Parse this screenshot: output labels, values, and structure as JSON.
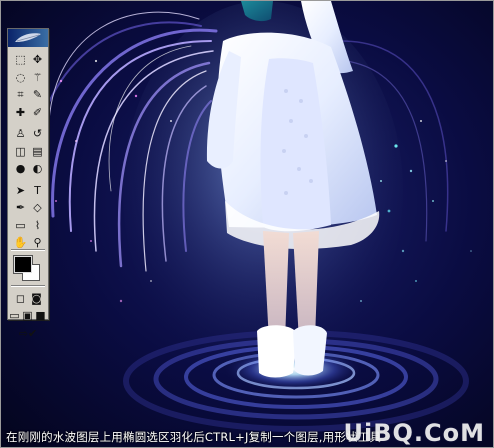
{
  "caption": "在刚刚的水波图层上用椭圆选区羽化后CTRL+J复制一个图层,用形状工具",
  "watermark": "UiBQ.CoM",
  "colors": {
    "background": "#06072e",
    "swirl": "#8a7cf2",
    "glow": "#dff6ff",
    "coat": "#eef3ff",
    "toolbox": "#d4d0c8"
  },
  "toolbox": {
    "tools": [
      {
        "name": "marquee-tool-icon",
        "glyph": "⬚"
      },
      {
        "name": "move-tool-icon",
        "glyph": "✥"
      },
      {
        "name": "lasso-tool-icon",
        "glyph": "◌"
      },
      {
        "name": "magic-wand-tool-icon",
        "glyph": "⚚"
      },
      {
        "name": "crop-tool-icon",
        "glyph": "⌗"
      },
      {
        "name": "slice-tool-icon",
        "glyph": "✎"
      },
      {
        "name": "healing-brush-tool-icon",
        "glyph": "✚"
      },
      {
        "name": "brush-tool-icon",
        "glyph": "✐"
      },
      {
        "name": "clone-stamp-tool-icon",
        "glyph": "♙"
      },
      {
        "name": "history-brush-tool-icon",
        "glyph": "↺"
      },
      {
        "name": "eraser-tool-icon",
        "glyph": "◫"
      },
      {
        "name": "gradient-tool-icon",
        "glyph": "▤"
      },
      {
        "name": "blur-tool-icon",
        "glyph": "●"
      },
      {
        "name": "dodge-tool-icon",
        "glyph": "◐"
      },
      {
        "name": "path-selection-tool-icon",
        "glyph": "➤"
      },
      {
        "name": "type-tool-icon",
        "glyph": "T"
      },
      {
        "name": "pen-tool-icon",
        "glyph": "✒"
      },
      {
        "name": "shape-tool-icon",
        "glyph": "◇"
      },
      {
        "name": "notes-tool-icon",
        "glyph": "▭"
      },
      {
        "name": "eyedropper-tool-icon",
        "glyph": "⌇"
      },
      {
        "name": "hand-tool-icon",
        "glyph": "✋"
      },
      {
        "name": "zoom-tool-icon",
        "glyph": "⚲"
      }
    ],
    "foreground_color": "#000000",
    "background_color": "#ffffff"
  }
}
